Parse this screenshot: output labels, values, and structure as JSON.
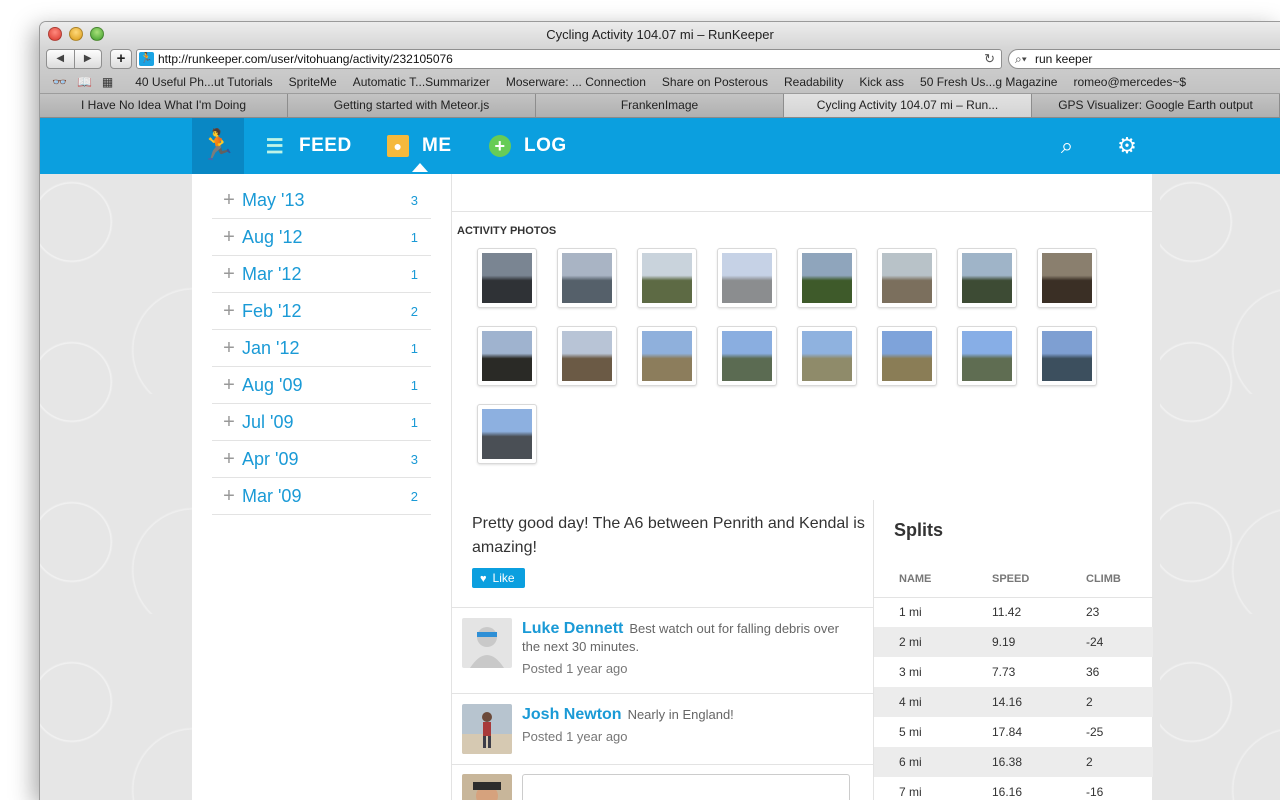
{
  "window": {
    "title": "Cycling Activity 104.07 mi – RunKeeper"
  },
  "toolbar": {
    "back": "◀",
    "forward": "▶",
    "add": "+",
    "url": "http://runkeeper.com/user/vitohuang/activity/232105076",
    "search": "run keeper"
  },
  "bookmarks": [
    "40 Useful Ph...ut Tutorials",
    "SpriteMe",
    "Automatic T...Summarizer",
    "Moserware: ... Connection",
    "Share on Posterous",
    "Readability",
    "Kick ass",
    "50 Fresh Us...g Magazine",
    "romeo@mercedes~$"
  ],
  "tabs": [
    {
      "label": "I Have No Idea What I'm Doing"
    },
    {
      "label": "Getting started with Meteor.js"
    },
    {
      "label": "FrankenImage"
    },
    {
      "label": "Cycling Activity 104.07 mi – Run..."
    },
    {
      "label": "GPS Visualizer: Google Earth output"
    }
  ],
  "nav": {
    "feed": "FEED",
    "me": "ME",
    "log": "LOG"
  },
  "months": [
    {
      "label": "May '13",
      "count": "3"
    },
    {
      "label": "Aug '12",
      "count": "1"
    },
    {
      "label": "Mar '12",
      "count": "1"
    },
    {
      "label": "Feb '12",
      "count": "2"
    },
    {
      "label": "Jan '12",
      "count": "1"
    },
    {
      "label": "Aug '09",
      "count": "1"
    },
    {
      "label": "Jul '09",
      "count": "1"
    },
    {
      "label": "Apr '09",
      "count": "3"
    },
    {
      "label": "Mar '09",
      "count": "2"
    }
  ],
  "photos": {
    "title": "ACTIVITY PHOTOS",
    "items": [
      {
        "c1": "#7a8592",
        "c2": "#2f3236"
      },
      {
        "c1": "#a9b4c4",
        "c2": "#55606a"
      },
      {
        "c1": "#c9d3dc",
        "c2": "#5d6a44"
      },
      {
        "c1": "#c6d2e6",
        "c2": "#8b8d8f"
      },
      {
        "c1": "#8fa5bc",
        "c2": "#3e5a2a"
      },
      {
        "c1": "#b8c2c8",
        "c2": "#7b6f5d"
      },
      {
        "c1": "#9fb4c8",
        "c2": "#3d4b34"
      },
      {
        "c1": "#8a7f6e",
        "c2": "#3a2f25"
      },
      {
        "c1": "#9fb3cf",
        "c2": "#2a2a26"
      },
      {
        "c1": "#b8c4d6",
        "c2": "#6b5a45"
      },
      {
        "c1": "#8fb0dc",
        "c2": "#8c7d5c"
      },
      {
        "c1": "#8aaee0",
        "c2": "#5b6b52"
      },
      {
        "c1": "#8fb2df",
        "c2": "#8f8b6a"
      },
      {
        "c1": "#7ea3da",
        "c2": "#8a7d56"
      },
      {
        "c1": "#87aee6",
        "c2": "#5f6d52"
      },
      {
        "c1": "#7e9fd2",
        "c2": "#3c4f5e"
      },
      {
        "c1": "#8db0e0",
        "c2": "#4a4f55"
      }
    ]
  },
  "status": {
    "text": "Pretty good day! The A6 between Penrith and Kendal is amazing!",
    "like": "Like"
  },
  "comments": [
    {
      "name": "Luke Dennett",
      "message": "Best watch out for falling debris over the next 30 minutes.",
      "posted": "Posted 1 year ago"
    },
    {
      "name": "Josh Newton",
      "message": "Nearly in England!",
      "posted": "Posted 1 year ago"
    }
  ],
  "splits": {
    "title": "Splits",
    "headers": [
      "NAME",
      "SPEED",
      "CLIMB"
    ],
    "rows": [
      [
        "1 mi",
        "11.42",
        "23"
      ],
      [
        "2 mi",
        "9.19",
        "-24"
      ],
      [
        "3 mi",
        "7.73",
        "36"
      ],
      [
        "4 mi",
        "14.16",
        "2"
      ],
      [
        "5 mi",
        "17.84",
        "-25"
      ],
      [
        "6 mi",
        "16.38",
        "2"
      ],
      [
        "7 mi",
        "16.16",
        "-16"
      ]
    ]
  },
  "colors": {
    "brand": "#0b9fdf",
    "brand_dark": "#0987c4",
    "link": "#1a9ad6"
  }
}
